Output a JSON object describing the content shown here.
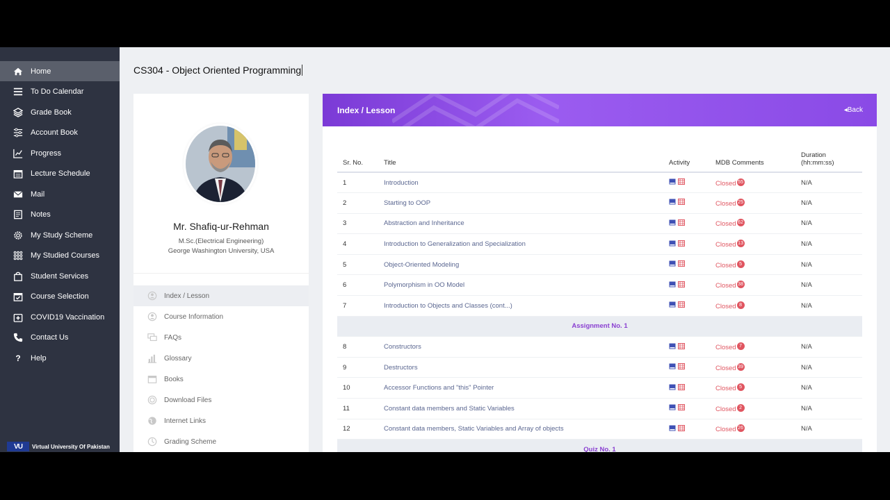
{
  "sidebar": {
    "items": [
      {
        "label": "Home",
        "icon": "home-icon",
        "active": true
      },
      {
        "label": "To Do Calendar",
        "icon": "list-icon"
      },
      {
        "label": "Grade Book",
        "icon": "layers-icon"
      },
      {
        "label": "Account Book",
        "icon": "sliders-icon"
      },
      {
        "label": "Progress",
        "icon": "chart-icon"
      },
      {
        "label": "Lecture Schedule",
        "icon": "calendar-icon"
      },
      {
        "label": "Mail",
        "icon": "mail-icon"
      },
      {
        "label": "Notes",
        "icon": "notes-icon"
      },
      {
        "label": "My Study Scheme",
        "icon": "gear-icon"
      },
      {
        "label": "My Studied Courses",
        "icon": "grid-icon"
      },
      {
        "label": "Student Services",
        "icon": "bag-icon"
      },
      {
        "label": "Course Selection",
        "icon": "calendar-check-icon"
      },
      {
        "label": "COVID19 Vaccination",
        "icon": "syringe-icon"
      },
      {
        "label": "Contact Us",
        "icon": "phone-icon"
      },
      {
        "label": "Help",
        "icon": "question-icon"
      }
    ],
    "logo_mark": "VU",
    "logo_text": "Virtual University Of Pakistan"
  },
  "course": {
    "title": "CS304 - Object Oriented Programming"
  },
  "profile": {
    "name": "Mr. Shafiq-ur-Rehman",
    "degree": "M.Sc.(Electrical Engineering)",
    "university": "George Washington University, USA"
  },
  "menu": [
    {
      "label": "Index / Lesson",
      "active": true
    },
    {
      "label": "Course Information"
    },
    {
      "label": "FAQs"
    },
    {
      "label": "Glossary"
    },
    {
      "label": "Books"
    },
    {
      "label": "Download Files"
    },
    {
      "label": "Internet Links"
    },
    {
      "label": "Grading Scheme"
    }
  ],
  "lesson_panel": {
    "title": "Index / Lesson",
    "back": "Back",
    "columns": {
      "sr": "Sr. No.",
      "title": "Title",
      "activity": "Activity",
      "mdb": "MDB Comments",
      "duration_1": "Duration",
      "duration_2": "(hh:mm:ss)"
    },
    "rows": [
      {
        "sr": "1",
        "title": "Introduction",
        "status": "Closed",
        "count": "55",
        "duration": "N/A"
      },
      {
        "sr": "2",
        "title": "Starting to OOP",
        "status": "Closed",
        "count": "25",
        "duration": "N/A"
      },
      {
        "sr": "3",
        "title": "Abstraction and Inheritance",
        "status": "Closed",
        "count": "62",
        "duration": "N/A"
      },
      {
        "sr": "4",
        "title": "Introduction to Generalization and Specialization",
        "status": "Closed",
        "count": "13",
        "duration": "N/A"
      },
      {
        "sr": "5",
        "title": "Object-Oriented Modeling",
        "status": "Closed",
        "count": "5",
        "duration": "N/A"
      },
      {
        "sr": "6",
        "title": "Polymorphism in OO Model",
        "status": "Closed",
        "count": "38",
        "duration": "N/A"
      },
      {
        "sr": "7",
        "title": "Introduction to Objects and Classes (cont...)",
        "status": "Closed",
        "count": "8",
        "duration": "N/A"
      },
      {
        "section": "Assignment No. 1"
      },
      {
        "sr": "8",
        "title": "Constructors",
        "status": "Closed",
        "count": "7",
        "duration": "N/A"
      },
      {
        "sr": "9",
        "title": "Destructors",
        "status": "Closed",
        "count": "39",
        "duration": "N/A"
      },
      {
        "sr": "10",
        "title": "Accessor Functions and \"this\" Pointer",
        "status": "Closed",
        "count": "5",
        "duration": "N/A"
      },
      {
        "sr": "11",
        "title": "Constant data members and Static Variables",
        "status": "Closed",
        "count": "2",
        "duration": "N/A"
      },
      {
        "sr": "12",
        "title": "Constant data members, Static Variables and Array of objects",
        "status": "Closed",
        "count": "26",
        "duration": "N/A"
      },
      {
        "section": "Quiz No. 1"
      }
    ]
  },
  "colors": {
    "sidebar_bg": "#2e3341",
    "accent_purple": "#8a3fd1",
    "closed_red": "#e05560"
  }
}
